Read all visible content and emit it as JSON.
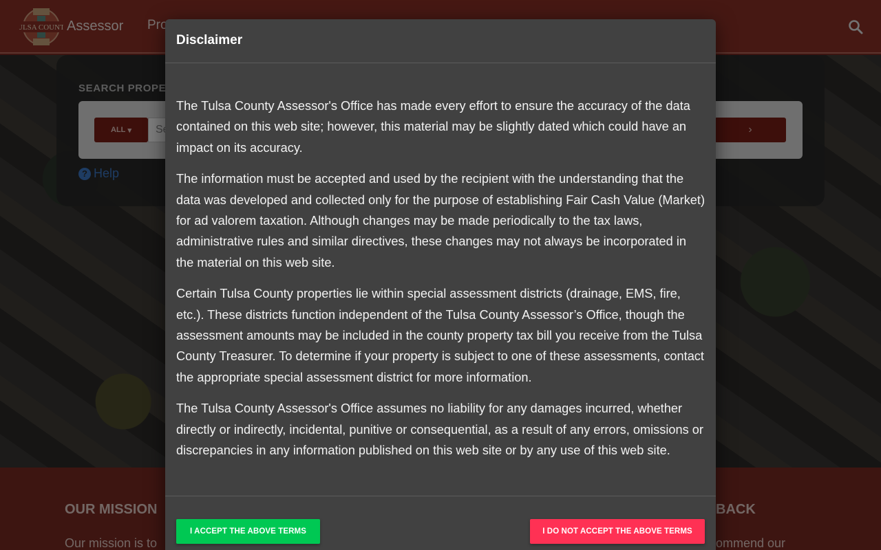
{
  "header": {
    "brand": "Assessor",
    "nav_item": "Pro",
    "logo_text": "TULSA COUNTY"
  },
  "search": {
    "title": "SEARCH PROPE",
    "dropdown_label": "ALL",
    "placeholder": "Se",
    "button_label": "›",
    "help_label": "Help"
  },
  "footer": {
    "mission_title": "OUR MISSION",
    "mission_text": "Our mission is to",
    "feedback_title": "BACK",
    "feedback_text": "ommend our"
  },
  "modal": {
    "title": "Disclaimer",
    "paragraphs": [
      "The Tulsa County Assessor's Office has made every effort to ensure the accuracy of the data contained on this web site; however, this material may be slightly dated which could have an impact on its accuracy.",
      "The information must be accepted and used by the recipient with the understanding that the data was developed and collected only for the purpose of establishing Fair Cash Value (Market) for ad valorem taxation. Although changes may be made periodically to the tax laws, administrative rules and similar directives, these changes may not always be incorporated in the material on this web site.",
      "Certain Tulsa County properties lie within special assessment districts (drainage, EMS, fire, etc.). These districts function independent of the Tulsa County Assessor’s Office, though the assessment amounts may be included in the county property tax bill you receive from the Tulsa County Treasurer. To determine if your property is subject to one of these assessments, contact the appropriate special assessment district for more information.",
      "The Tulsa County Assessor's Office assumes no liability for any damages incurred, whether directly or indirectly, incidental, punitive or consequential, as a result of any errors, omissions or discrepancies in any information published on this web site or by any use of this web site."
    ],
    "accept_label": "I ACCEPT THE ABOVE TERMS",
    "decline_label": "I DO NOT ACCEPT THE ABOVE TERMS"
  },
  "colors": {
    "brand": "#8d3127",
    "accept": "#00c853",
    "decline": "#ff3154",
    "modal_bg": "#414141"
  }
}
